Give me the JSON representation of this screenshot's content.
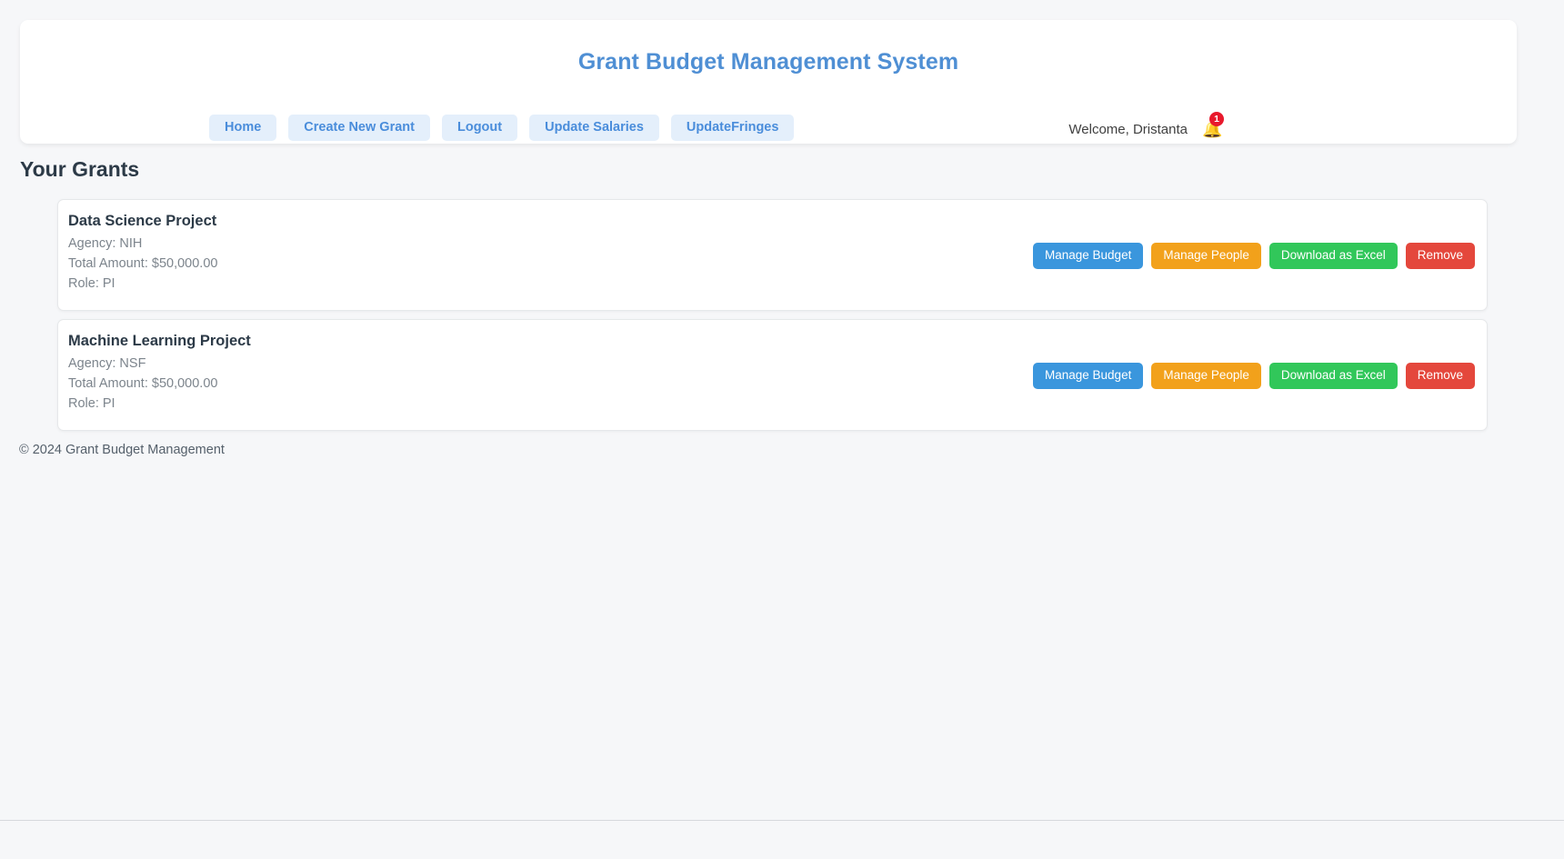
{
  "header": {
    "app_title": "Grant Budget Management System",
    "nav_items": [
      {
        "label": "Home",
        "name": "nav-home"
      },
      {
        "label": "Create New Grant",
        "name": "nav-create-new-grant"
      },
      {
        "label": "Logout",
        "name": "nav-logout"
      },
      {
        "label": "Update Salaries",
        "name": "nav-update-salaries"
      },
      {
        "label": "UpdateFringes",
        "name": "nav-update-fringes"
      }
    ],
    "welcome": "Welcome, Dristanta",
    "notification_icon": "bell-icon",
    "notification_count": "1"
  },
  "main": {
    "section_title": "Your Grants",
    "grants": [
      {
        "name": "Data Science Project",
        "agency": "Agency: NIH",
        "total": "Total Amount: $50,000.00",
        "role": "Role: PI"
      },
      {
        "name": "Machine Learning Project",
        "agency": "Agency: NSF",
        "total": "Total Amount: $50,000.00",
        "role": "Role: PI"
      }
    ],
    "actions": {
      "manage_budget": "Manage Budget",
      "manage_people": "Manage People",
      "download_excel": "Download as Excel",
      "remove": "Remove"
    }
  },
  "footer": {
    "copyright": "© 2024 Grant Budget Management"
  },
  "colors": {
    "page_background": "#f6f7f9",
    "brand_blue": "#4f8fd4",
    "nav_button_background": "#e4effb",
    "nav_button_text": "#4a8ddb",
    "manage_budget": "#3a96dd",
    "manage_people": "#f2a11b",
    "download_excel": "#31c75a",
    "remove": "#e4473c",
    "badge_red": "#e8192c",
    "bell_gold": "#f5b731"
  }
}
